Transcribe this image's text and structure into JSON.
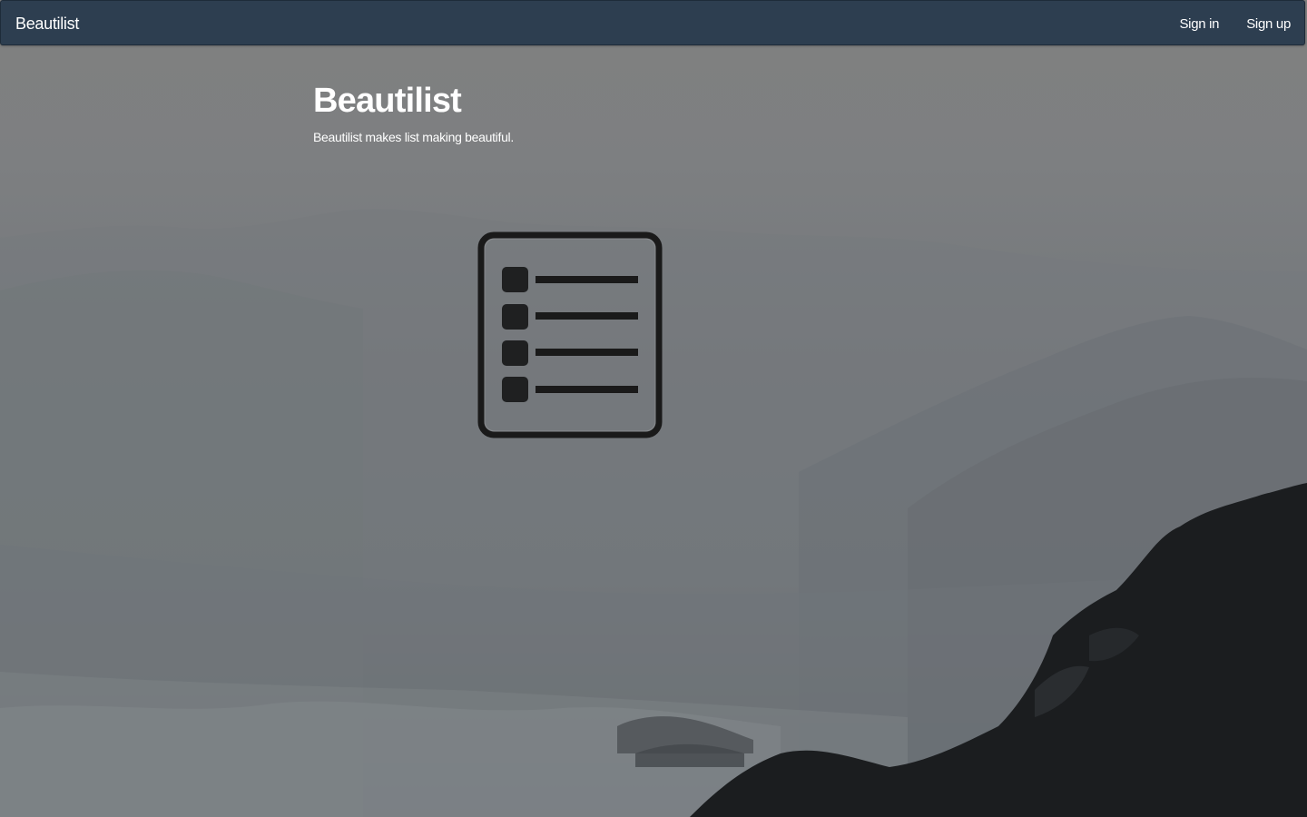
{
  "navbar": {
    "brand": "Beautilist",
    "links": [
      {
        "label": "Sign in"
      },
      {
        "label": "Sign up"
      }
    ]
  },
  "hero": {
    "title": "Beautilist",
    "subtitle": "Beautilist makes list making beautiful."
  },
  "icons": {
    "hero_icon": "list-icon",
    "background": "misty-coastline-image"
  },
  "colors": {
    "navbar_bg": "#2d3e50",
    "text": "#ffffff",
    "icon_stroke": "#1a1a1a"
  }
}
